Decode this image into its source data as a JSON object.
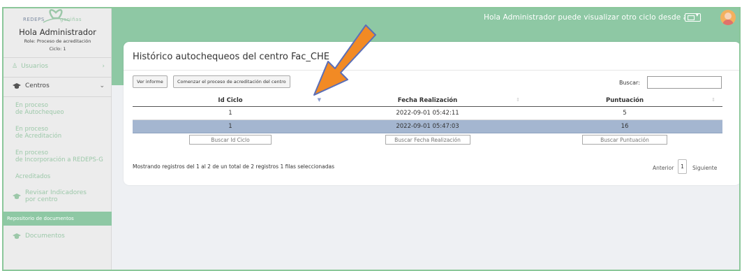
{
  "logo": {
    "text_left": "REDEPS",
    "text_right": "ganiñas"
  },
  "sidebar": {
    "greeting": "Hola Administrador",
    "role": "Role: Proceso de acreditación",
    "cycle": "Ciclo: 1",
    "usuarios": "Usuarios",
    "centros": "Centros",
    "sub_autochequeo": [
      "En proceso",
      "de Autochequeo"
    ],
    "sub_acreditacion": [
      "En proceso",
      "de Acreditación"
    ],
    "sub_incorporacion": [
      "En proceso",
      "de Incorporación a REDEPS-G"
    ],
    "acreditados": "Acreditados",
    "revisar": [
      "Revisar Indicadores",
      "por centro"
    ],
    "repositorio": "Repositorio de documentos",
    "documentos": "Documentos"
  },
  "header": {
    "greeting": "Hola Administrador puede visualizar otro ciclo desde aquí:"
  },
  "panel": {
    "title": "Histórico autochequeos del centro Fac_CHE",
    "btn_report": "Ver informe",
    "btn_start": "Comenzar el proceso de acreditación del centro",
    "search_label": "Buscar:",
    "columns": [
      "Id Ciclo",
      "Fecha Realización",
      "Puntuación"
    ],
    "rows": [
      [
        "1",
        "2022-09-01 05:42:11",
        "5"
      ],
      [
        "1",
        "2022-09-01 05:47:03",
        "16"
      ]
    ],
    "filters": [
      "Buscar Id Ciclo",
      "Buscar Fecha Realización",
      "Buscar Puntuación"
    ],
    "info": "Mostrando registros del 1 al 2 de un total de 2 registros    1 filas seleccionadas",
    "prev": "Anterior",
    "page": "1",
    "next": "Siguiente"
  }
}
